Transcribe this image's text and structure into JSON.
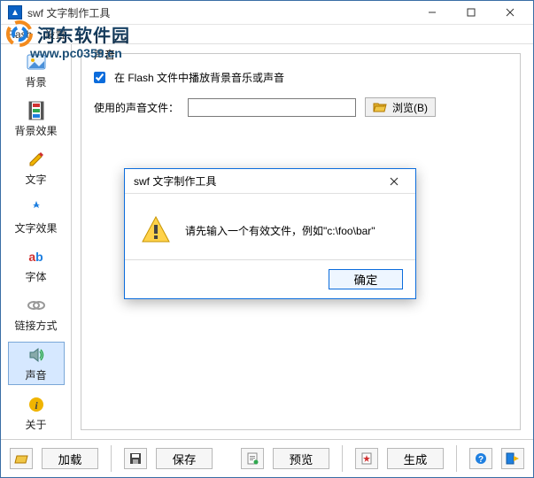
{
  "window": {
    "title": "swf 文字制作工具"
  },
  "menu": {
    "flash": "Flash",
    "settings": "设置"
  },
  "sidebar": {
    "items": [
      {
        "label": "背景",
        "name": "background"
      },
      {
        "label": "背景效果",
        "name": "background-effect"
      },
      {
        "label": "文字",
        "name": "text"
      },
      {
        "label": "文字效果",
        "name": "text-effect"
      },
      {
        "label": "字体",
        "name": "font"
      },
      {
        "label": "链接方式",
        "name": "link-mode"
      },
      {
        "label": "声音",
        "name": "sound"
      },
      {
        "label": "关于",
        "name": "about"
      }
    ]
  },
  "panel": {
    "legend": "声音",
    "checkbox_label": "在 Flash 文件中播放背景音乐或声音",
    "checked": true,
    "file_label": "使用的声音文件：",
    "file_value": "",
    "browse_label": "浏览(B)"
  },
  "dialog": {
    "title": "swf 文字制作工具",
    "message": "请先输入一个有效文件，例如\"c:\\foo\\bar\"",
    "ok_label": "确定"
  },
  "statusbar": {
    "load_label": "加载",
    "save_label": "保存",
    "preview_label": "预览",
    "generate_label": "生成"
  },
  "watermark": {
    "site_name": "河东软件园",
    "url": "www.pc0359.cn"
  }
}
